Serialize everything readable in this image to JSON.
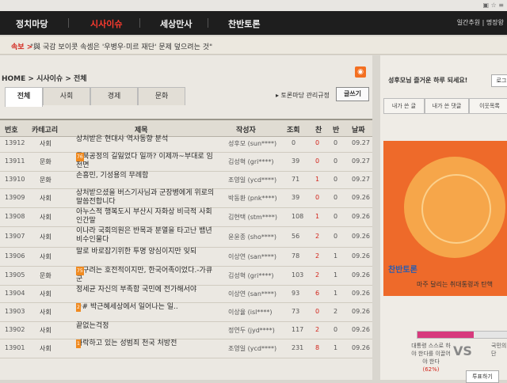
{
  "nav": {
    "items": [
      "정치마당",
      "시사이슈",
      "세상만사",
      "찬반토론"
    ],
    "right_text": "일간추원 | 명장왕"
  },
  "breaking": {
    "label": "속보 >",
    "text": "\"與 국감 보이콧 속셈은 '우병우·미르 재단' 문제 덮으려는 것\""
  },
  "breadcrumb": "HOME > 시사이슈 > 전체",
  "tabs": [
    "전체",
    "사회",
    "경제",
    "문화"
  ],
  "guide_link": "▸ 토론마당 관리규정",
  "write_button": "글쓰기",
  "table": {
    "headers": [
      "번호",
      "카테고리",
      "제목",
      "작성자",
      "조회",
      "찬",
      "반",
      "날짜"
    ],
    "rows": [
      {
        "no": "13912",
        "cat": "사회",
        "title": "상처받은 현대사 역사동향 분석",
        "count": "",
        "author": "성후모 (sun****)",
        "views": "0",
        "rec": "0",
        "opp": "0",
        "date": "09.27"
      },
      {
        "no": "13911",
        "cat": "문화",
        "title": "동북공정의 길잃었다 일까? 이제까~부대로 임천면",
        "count": "76",
        "author": "김성혁 (gri****)",
        "views": "39",
        "rec": "0",
        "opp": "0",
        "date": "09.27"
      },
      {
        "no": "13910",
        "cat": "문화",
        "title": "손흥민, 기성용의 무례함",
        "count": "",
        "author": "조영일 (ycd****)",
        "views": "71",
        "rec": "1",
        "opp": "0",
        "date": "09.27"
      },
      {
        "no": "13909",
        "cat": "사회",
        "title": "상처받으셨을 버스기사님과 군장병에게 위로의 말씀전합니다",
        "count": "",
        "author": "박동환 (pnk****)",
        "views": "39",
        "rec": "0",
        "opp": "0",
        "date": "09.26"
      },
      {
        "no": "13908",
        "cat": "사회",
        "title": "아누스적 행복도시 부산시 자화상 비극적 사회 인간말",
        "count": "",
        "author": "김현택 (stm****)",
        "views": "108",
        "rec": "1",
        "opp": "0",
        "date": "09.26"
      },
      {
        "no": "13907",
        "cat": "사회",
        "title": "이나라 국회의원은 반목과 분열을 타고난 뱀년 비수인물다",
        "count": "",
        "author": "윤윤종 (sho****)",
        "views": "56",
        "rec": "2",
        "opp": "0",
        "date": "09.26"
      },
      {
        "no": "13906",
        "cat": "사회",
        "title": "말로 바로잡기위한 투명 양심이지만 잊되",
        "count": "",
        "author": "이상연 (san****)",
        "views": "78",
        "rec": "2",
        "opp": "1",
        "date": "09.26"
      },
      {
        "no": "13905",
        "cat": "문화",
        "title": "고구려는 호전적이지만, 한국어족이었다.-가큐군",
        "count": "75",
        "author": "김성혁 (gri****)",
        "views": "103",
        "rec": "2",
        "opp": "1",
        "date": "09.26"
      },
      {
        "no": "13904",
        "cat": "사회",
        "title": "정세균 자신의 부족함 국민에 전가해서야",
        "count": "",
        "author": "이상연 (san****)",
        "views": "93",
        "rec": "6",
        "opp": "1",
        "date": "09.26"
      },
      {
        "no": "13903",
        "cat": "사회",
        "title": "## 박근혜세상에서 일어나는 일..",
        "count": "2",
        "author": "이상율 (isl****)",
        "views": "73",
        "rec": "0",
        "opp": "2",
        "date": "09.26"
      },
      {
        "no": "13902",
        "cat": "사회",
        "title": "끝없는걱정",
        "count": "",
        "author": "정연두 (jyd****)",
        "views": "117",
        "rec": "2",
        "opp": "0",
        "date": "09.26"
      },
      {
        "no": "13901",
        "cat": "사회",
        "title": "타락하고 있는 성범죄 천국 처방전",
        "count": "1",
        "author": "조영일 (ycd****)",
        "views": "231",
        "rec": "8",
        "opp": "1",
        "date": "09.26"
      }
    ]
  },
  "sidebar": {
    "login_text": "성후모님 즐거운 하루 되세요!",
    "login_button": "로그",
    "tabs": [
      "내가 쓴 글",
      "내가 쓴 댓글",
      "이웃목록"
    ],
    "debate_title": "찬반토론",
    "debate_question": "마주 달리는 취대통령과 탄핵",
    "vote_pct": 0.62,
    "left_label": "대통령 스스로 하야 한다를 이끌어야 한다",
    "left_pct": "(62%)",
    "vs_label": "VS",
    "right_label": "국민의 판단",
    "vote_button": "투표하기"
  },
  "colors": {
    "accent": "#ff3b2f",
    "nav_bg": "#1e1e1e",
    "banner": "#ee6a2a"
  }
}
